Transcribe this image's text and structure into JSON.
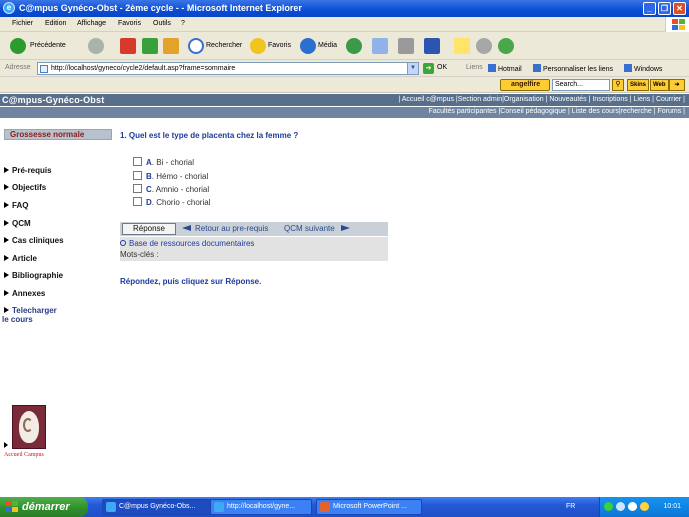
{
  "window": {
    "title": "C@mpus Gynéco-Obst - 2ème cycle - - Microsoft Internet Explorer"
  },
  "menu": {
    "items": [
      "Fichier",
      "Edition",
      "Affichage",
      "Favoris",
      "Outils",
      "?"
    ]
  },
  "toolbar": {
    "back_label": "Précédente",
    "search_label": "Rechercher",
    "favorites_label": "Favoris",
    "media_label": "Média"
  },
  "address": {
    "label": "Adresse",
    "url": "http://localhost/gyneco/cycle2/default.asp?frame=sommaire",
    "go_label": "OK",
    "links_label": "Liens",
    "links": [
      "Hotmail",
      "Personnaliser les liens",
      "Windows"
    ]
  },
  "angelfire": {
    "brand": "angelfire",
    "search_placeholder": "Search...",
    "skins_label": "Skins",
    "web_label": "Web"
  },
  "site": {
    "brand": "C@mpus-Gynéco-Obst",
    "top_nav": "| Accueil c@mpus |Section admin|Organisation | Nouveautés | Inscriptions | Liens | Courrier |",
    "sub_nav": "Facultés participantes |Conseil pédagogique | Liste des cours|recherche | Forums |"
  },
  "sidebar": {
    "section_title": "Grossesse normale",
    "items": [
      {
        "label": "Pré-requis"
      },
      {
        "label": "Objectifs"
      },
      {
        "label": "FAQ"
      },
      {
        "label": "QCM"
      },
      {
        "label": "Cas cliniques"
      },
      {
        "label": "Article"
      },
      {
        "label": "Bibliographie"
      },
      {
        "label": "Annexes"
      }
    ],
    "download_line1": "Telecharger",
    "download_line2": "le cours",
    "logo_caption": "Accueil Campus"
  },
  "qcm": {
    "question": "1. Quel est le type de placenta chez la femme ?",
    "options": [
      {
        "letter": "A",
        "text": ". Bi - chorial"
      },
      {
        "letter": "B",
        "text": ". Hémo - chorial"
      },
      {
        "letter": "C",
        "text": ". Amnio - chorial"
      },
      {
        "letter": "D",
        "text": ". Chorio - chorial"
      }
    ],
    "answer_button": "Réponse",
    "back_link": "Retour au pre-requis",
    "next_link": "QCM suivante",
    "resources_link": "Base de ressources documentaires",
    "keywords_label": "Mots-clés :",
    "instruction": "Répondez, puis cliquez sur Réponse."
  },
  "taskbar": {
    "start_label": "démarrer",
    "tasks": [
      {
        "label": "C@mpus Gynéco-Obs..."
      },
      {
        "label": "http://localhost/gyne..."
      },
      {
        "label": "Microsoft PowerPoint ..."
      }
    ],
    "lang": "FR",
    "clock": "10:01"
  }
}
